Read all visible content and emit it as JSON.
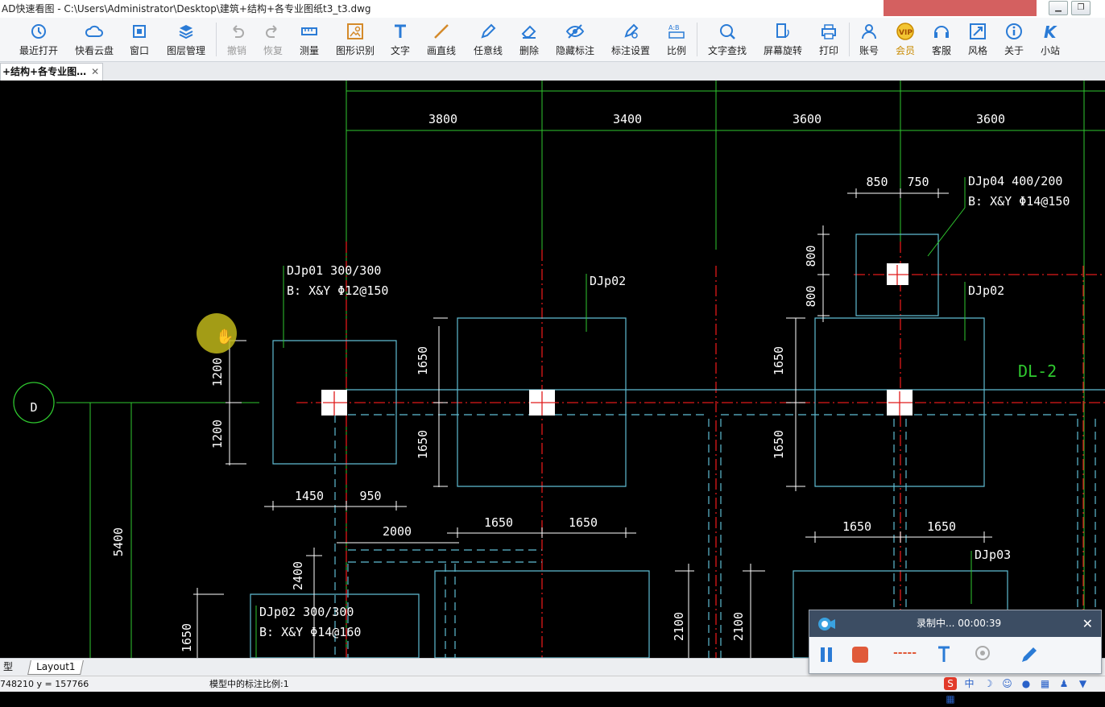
{
  "window": {
    "title": "AD快速看图 - C:\\Users\\Administrator\\Desktop\\建筑+结构+各专业图纸t3_t3.dwg",
    "min_label": "▁",
    "max_label": "❐"
  },
  "toolbar": {
    "items": [
      {
        "label": "最近打开",
        "icon": "recent-icon"
      },
      {
        "label": "快看云盘",
        "icon": "cloud-icon"
      },
      {
        "label": "窗口",
        "icon": "window-icon"
      },
      {
        "label": "图层管理",
        "icon": "layers-icon"
      },
      {
        "label": "撤销",
        "icon": "undo-icon"
      },
      {
        "label": "恢复",
        "icon": "redo-icon"
      },
      {
        "label": "测量",
        "icon": "ruler-icon"
      },
      {
        "label": "图形识别",
        "icon": "shape-recognize-icon"
      },
      {
        "label": "文字",
        "icon": "text-icon"
      },
      {
        "label": "画直线",
        "icon": "line-icon"
      },
      {
        "label": "任意线",
        "icon": "pen-icon"
      },
      {
        "label": "删除",
        "icon": "eraser-icon"
      },
      {
        "label": "隐藏标注",
        "icon": "eye-off-icon"
      },
      {
        "label": "标注设置",
        "icon": "annotation-settings-icon"
      },
      {
        "label": "比例",
        "icon": "scale-icon"
      },
      {
        "label": "文字查找",
        "icon": "text-search-icon"
      },
      {
        "label": "屏幕旋转",
        "icon": "rotate-icon"
      },
      {
        "label": "打印",
        "icon": "print-icon"
      },
      {
        "label": "账号",
        "icon": "user-icon"
      },
      {
        "label": "会员",
        "icon": "vip-icon"
      },
      {
        "label": "客服",
        "icon": "headset-icon"
      },
      {
        "label": "风格",
        "icon": "style-icon"
      },
      {
        "label": "关于",
        "icon": "info-icon"
      },
      {
        "label": "小站",
        "icon": "k-logo-icon"
      }
    ]
  },
  "tab": {
    "label": "+结构+各专业图…",
    "close": "✕"
  },
  "drawing": {
    "axis_label": "D",
    "beam_label": "DL-2",
    "dims_top": [
      "3800",
      "3400",
      "3600",
      "3600"
    ],
    "dims": {
      "d850": "850",
      "d750": "750",
      "d800a": "800",
      "d800b": "800",
      "d1200a": "1200",
      "d1200b": "1200",
      "d1650a": "1650",
      "d1650b": "1650",
      "d1650c": "1650",
      "d1650d": "1650",
      "d1450": "1450",
      "d950": "950",
      "d2000": "2000",
      "d1650e": "1650",
      "d1650f": "1650",
      "d1650g": "1650",
      "d1650h": "1650",
      "d5400": "5400",
      "d2400": "2400",
      "d2100a": "2100",
      "d2100b": "2100",
      "d1650i": "1650"
    },
    "labels": {
      "djp01_a": "DJp01 300/300",
      "djp01_b": "B: X&Y Φ12@150",
      "djp02_top": "DJp02",
      "djp04_a": "DJp04 400/200",
      "djp04_b": "B: X&Y Φ14@150",
      "djp02_right": "DJp02",
      "djp03": "DJp03",
      "djp02_bl_a": "DJp02 300/300",
      "djp02_bl_b": "B: X&Y Φ14@160"
    }
  },
  "layout_tabs": {
    "model": "型",
    "layout1": "Layout1"
  },
  "status": {
    "coords": "748210 y = 157766",
    "scale": "模型中的标注比例:1"
  },
  "recorder": {
    "status": "录制中... 00:00:39",
    "close": "✕",
    "dash": "-----"
  },
  "tray": {
    "ime": "中"
  },
  "colors": {
    "canvas": "#000000",
    "green": "#2fc92f",
    "red": "#e01a1a",
    "cyan": "#5fbcd3",
    "white": "#ffffff"
  }
}
